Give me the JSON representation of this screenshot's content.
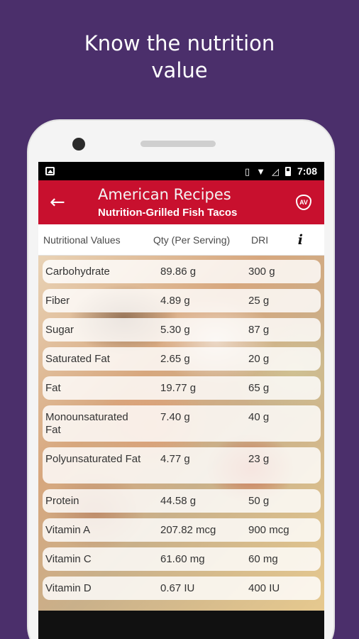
{
  "promo": {
    "line1": "Know the nutrition",
    "line2": "value"
  },
  "statusbar": {
    "time": "7:08"
  },
  "appbar": {
    "title": "American Recipes",
    "subtitle": "Nutrition-Grilled Fish Tacos",
    "logo_text": "AV"
  },
  "table": {
    "headers": {
      "name": "Nutritional Values",
      "qty": "Qty (Per Serving)",
      "dri": "DRI",
      "info": "i"
    },
    "rows": [
      {
        "name": "Carbohydrate",
        "qty": "89.86 g",
        "dri": "300 g"
      },
      {
        "name": "Fiber",
        "qty": "4.89 g",
        "dri": "25 g"
      },
      {
        "name": "Sugar",
        "qty": "5.30 g",
        "dri": "87 g"
      },
      {
        "name": "Saturated Fat",
        "qty": "2.65 g",
        "dri": "20 g"
      },
      {
        "name": "Fat",
        "qty": "19.77 g",
        "dri": "65 g"
      },
      {
        "name": "Monounsaturated Fat",
        "qty": "7.40 g",
        "dri": "40 g"
      },
      {
        "name": "Polyunsaturated Fat",
        "qty": "4.77 g",
        "dri": "23 g"
      },
      {
        "name": "Protein",
        "qty": "44.58 g",
        "dri": "50 g"
      },
      {
        "name": "Vitamin A",
        "qty": "207.82 mcg",
        "dri": "900 mcg"
      },
      {
        "name": "Vitamin C",
        "qty": "61.60 mg",
        "dri": "60 mg"
      },
      {
        "name": "Vitamin D",
        "qty": "0.67 IU",
        "dri": "400 IU"
      }
    ]
  },
  "colors": {
    "background": "#4b2f6b",
    "appbar": "#c8102e"
  }
}
